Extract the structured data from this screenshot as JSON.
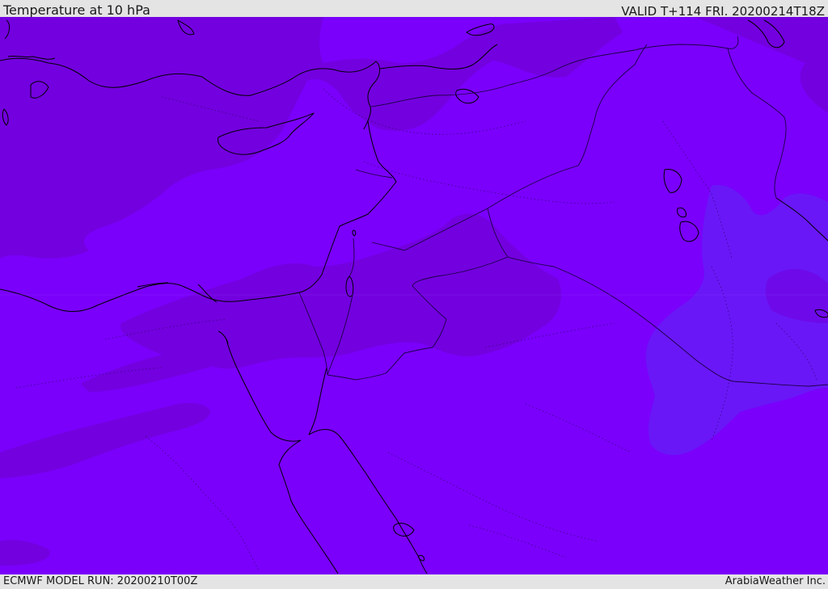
{
  "header": {
    "title": "Temperature at 10 hPa",
    "valid_time": "VALID T+114 FRI. 20200214T18Z"
  },
  "footer": {
    "model_run": "ECMWF MODEL RUN: 20200210T00Z",
    "credit": "ArabiaWeather Inc."
  },
  "map": {
    "variable": "temperature",
    "pressure_level": "10 hPa",
    "colors": {
      "base_fill": "#7a00fb",
      "darker_band": "#7300df",
      "cooler_band": "#6917f7",
      "coastline": "#000000",
      "borders": "#1b0042"
    }
  }
}
